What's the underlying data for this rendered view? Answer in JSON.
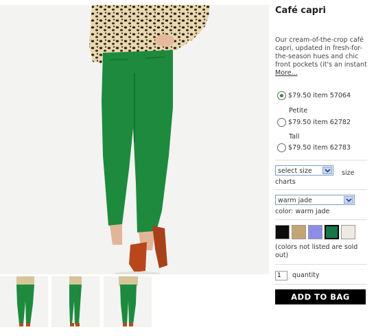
{
  "product": {
    "title": "Café capri",
    "description": "Our cream-of-the-crop café capri, updated in fresh-for-the-season hues and chic front pockets (it's an instant",
    "more_label": "More...",
    "options": [
      {
        "group_label": "",
        "price": "$79.50",
        "item": "item 57064",
        "text": "$79.50 item 57064",
        "selected": true
      },
      {
        "group_label": "Petite",
        "price": "$79.50",
        "item": "item 62782",
        "text": "$79.50 item 62782",
        "selected": false
      },
      {
        "group_label": "Tall",
        "price": "$79.50",
        "item": "item 62783",
        "text": "$79.50 item 62783",
        "selected": false
      }
    ],
    "size_select": {
      "value": "select size"
    },
    "size_charts_label": "size charts",
    "size_charts_part1": "size",
    "size_charts_part2": "charts",
    "color_select": {
      "value": "warm jade"
    },
    "color_label": "color: warm jade",
    "swatches": [
      {
        "name": "black",
        "color": "#0c0c0c"
      },
      {
        "name": "tan",
        "color": "#c4a574"
      },
      {
        "name": "periwinkle",
        "color": "#8c8ee6"
      },
      {
        "name": "warm jade",
        "color": "#17764a",
        "selected": true
      },
      {
        "name": "ivory",
        "color": "#eceae3"
      }
    ],
    "colors_note": "(colors not listed are sold out)",
    "quantity": {
      "value": "1",
      "label": "quantity"
    },
    "add_to_bag_label": "ADD TO BAG"
  },
  "colors": {
    "pants_green": "#1d8a3e",
    "shoe_orange": "#b8481c",
    "accent_green": "#2e8b3a"
  }
}
